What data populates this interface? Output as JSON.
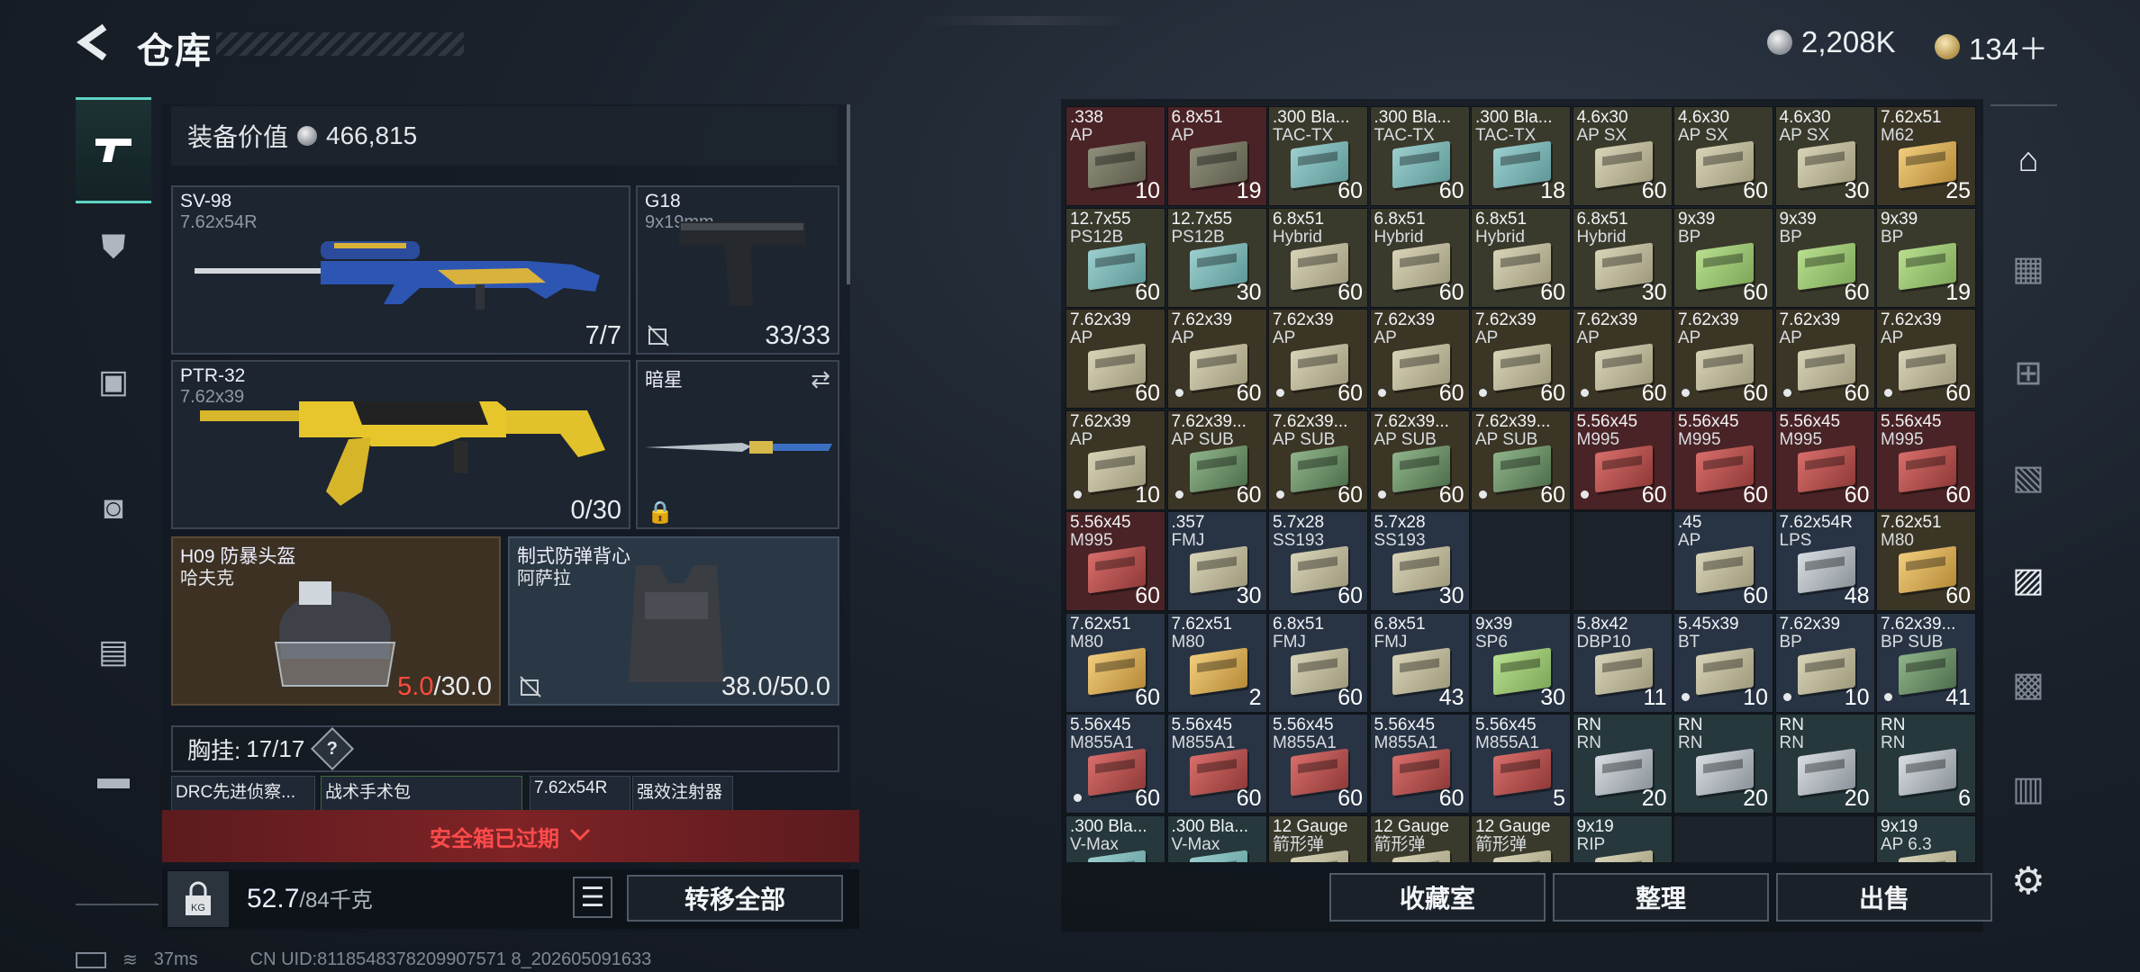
{
  "header": {
    "title": "仓库",
    "currency_silver": "2,208K",
    "currency_gold": "134＋"
  },
  "left": {
    "equip_value_label": "装备价值",
    "equip_value": "466,815",
    "slots": {
      "primary": {
        "name": "SV-98",
        "caliber": "7.62x54R",
        "count": "7/7"
      },
      "pistol": {
        "name": "G18",
        "caliber": "9x19mm",
        "count": "33/33"
      },
      "secondary": {
        "name": "PTR-32",
        "caliber": "7.62x39",
        "count": "0/30"
      },
      "melee": {
        "name": "暗星"
      },
      "helmet": {
        "name": "H09 防暴头盔",
        "sub": "哈夫克",
        "dur_cur": "5.0",
        "dur_max": "/30.0"
      },
      "armor": {
        "name": "制式防弹背心",
        "sub": "阿萨拉",
        "count": "38.0/50.0"
      }
    },
    "chest_rig_label": "胸挂:",
    "chest_rig_value": "17/17",
    "chest_help": "?",
    "mini_items": [
      "DRC先进侦察...",
      "战术手术包",
      "7.62x54R",
      "强效注射器"
    ],
    "safebox_expired": "安全箱已过期",
    "weight": "52.7",
    "weight_max": "/84千克",
    "transfer_all": "转移全部",
    "status_ping": "37ms",
    "status_uid": "CN UID:8118548378209907571 8_202605091633"
  },
  "grid": [
    [
      ".338",
      "AP",
      "10",
      "b-brown",
      "bg-red"
    ],
    [
      "6.8x51",
      "AP",
      "19",
      "b-brown",
      "bg-red"
    ],
    [
      ".300 Bla...",
      "TAC-TX",
      "60",
      "b-teal",
      "bg-olv"
    ],
    [
      ".300 Bla...",
      "TAC-TX",
      "60",
      "b-teal",
      "bg-olv"
    ],
    [
      ".300 Bla...",
      "TAC-TX",
      "18",
      "b-teal",
      "bg-olv"
    ],
    [
      "4.6x30",
      "AP SX",
      "60",
      "b-tan",
      "bg-olv"
    ],
    [
      "4.6x30",
      "AP SX",
      "60",
      "b-tan",
      "bg-olv"
    ],
    [
      "4.6x30",
      "AP SX",
      "30",
      "b-tan",
      "bg-olv"
    ],
    [
      "7.62x51",
      "M62",
      "25",
      "b-gold",
      "bg-brn"
    ],
    [
      "12.7x55",
      "PS12B",
      "60",
      "b-teal",
      "bg-olv"
    ],
    [
      "12.7x55",
      "PS12B",
      "30",
      "b-teal",
      "bg-olv"
    ],
    [
      "6.8x51",
      "Hybrid",
      "60",
      "b-tan",
      "bg-olv"
    ],
    [
      "6.8x51",
      "Hybrid",
      "60",
      "b-tan",
      "bg-olv"
    ],
    [
      "6.8x51",
      "Hybrid",
      "60",
      "b-tan",
      "bg-olv"
    ],
    [
      "6.8x51",
      "Hybrid",
      "30",
      "b-tan",
      "bg-olv"
    ],
    [
      "9x39",
      "BP",
      "60",
      "b-lime",
      "bg-olv"
    ],
    [
      "9x39",
      "BP",
      "60",
      "b-lime",
      "bg-olv"
    ],
    [
      "9x39",
      "BP",
      "19",
      "b-lime",
      "bg-olv"
    ],
    [
      "7.62x39",
      "AP",
      "60",
      "b-tan",
      "bg-brn"
    ],
    [
      "7.62x39",
      "AP",
      "60",
      "b-tan",
      "bg-brn"
    ],
    [
      "7.62x39",
      "AP",
      "60",
      "b-tan",
      "bg-brn"
    ],
    [
      "7.62x39",
      "AP",
      "60",
      "b-tan",
      "bg-brn"
    ],
    [
      "7.62x39",
      "AP",
      "60",
      "b-tan",
      "bg-brn"
    ],
    [
      "7.62x39",
      "AP",
      "60",
      "b-tan",
      "bg-brn"
    ],
    [
      "7.62x39",
      "AP",
      "60",
      "b-tan",
      "bg-brn"
    ],
    [
      "7.62x39",
      "AP",
      "60",
      "b-tan",
      "bg-brn"
    ],
    [
      "7.62x39",
      "AP",
      "60",
      "b-tan",
      "bg-brn"
    ],
    [
      "7.62x39",
      "AP",
      "10",
      "b-tan",
      "bg-brn"
    ],
    [
      "7.62x39...",
      "AP SUB",
      "60",
      "b-green",
      "bg-brn"
    ],
    [
      "7.62x39...",
      "AP SUB",
      "60",
      "b-green",
      "bg-brn"
    ],
    [
      "7.62x39...",
      "AP SUB",
      "60",
      "b-green",
      "bg-brn"
    ],
    [
      "7.62x39...",
      "AP SUB",
      "60",
      "b-green",
      "bg-brn"
    ],
    [
      "5.56x45",
      "M995",
      "60",
      "b-red",
      "bg-red"
    ],
    [
      "5.56x45",
      "M995",
      "60",
      "b-red",
      "bg-red"
    ],
    [
      "5.56x45",
      "M995",
      "60",
      "b-red",
      "bg-red"
    ],
    [
      "5.56x45",
      "M995",
      "60",
      "b-red",
      "bg-red"
    ],
    [
      "5.56x45",
      "M995",
      "60",
      "b-red",
      "bg-red"
    ],
    [
      ".357",
      "FMJ",
      "30",
      "b-tan",
      "bg-blu"
    ],
    [
      "5.7x28",
      "SS193",
      "60",
      "b-tan",
      "bg-blu"
    ],
    [
      "5.7x28",
      "SS193",
      "30",
      "b-tan",
      "bg-blu"
    ],
    [
      "",
      "",
      "",
      "",
      "bg-dk"
    ],
    [
      "",
      "",
      "",
      "",
      "bg-dk"
    ],
    [
      ".45",
      "AP",
      "60",
      "b-tan",
      "bg-blu"
    ],
    [
      "7.62x54R",
      "LPS",
      "48",
      "b-steel",
      "bg-blu"
    ],
    [
      "7.62x51",
      "M80",
      "60",
      "b-gold",
      "bg-brn"
    ],
    [
      "7.62x51",
      "M80",
      "60",
      "b-gold",
      "bg-blu"
    ],
    [
      "7.62x51",
      "M80",
      "2",
      "b-gold",
      "bg-blu"
    ],
    [
      "6.8x51",
      "FMJ",
      "60",
      "b-tan",
      "bg-blu"
    ],
    [
      "6.8x51",
      "FMJ",
      "43",
      "b-tan",
      "bg-blu"
    ],
    [
      "9x39",
      "SP6",
      "30",
      "b-lime",
      "bg-blu"
    ],
    [
      "5.8x42",
      "DBP10",
      "11",
      "b-tan",
      "bg-blu"
    ],
    [
      "5.45x39",
      "BT",
      "10",
      "b-tan",
      "bg-blu"
    ],
    [
      "7.62x39",
      "BP",
      "10",
      "b-tan",
      "bg-blu"
    ],
    [
      "7.62x39...",
      "BP SUB",
      "41",
      "b-green",
      "bg-blu"
    ],
    [
      "5.56x45",
      "M855A1",
      "60",
      "b-red",
      "bg-blu"
    ],
    [
      "5.56x45",
      "M855A1",
      "60",
      "b-red",
      "bg-blu"
    ],
    [
      "5.56x45",
      "M855A1",
      "60",
      "b-red",
      "bg-blu"
    ],
    [
      "5.56x45",
      "M855A1",
      "60",
      "b-red",
      "bg-blu"
    ],
    [
      "5.56x45",
      "M855A1",
      "5",
      "b-red",
      "bg-blu"
    ],
    [
      "RN",
      "RN",
      "20",
      "b-steel",
      "bg-teal"
    ],
    [
      "RN",
      "RN",
      "20",
      "b-steel",
      "bg-teal"
    ],
    [
      "RN",
      "RN",
      "20",
      "b-steel",
      "bg-teal"
    ],
    [
      "RN",
      "RN",
      "6",
      "b-steel",
      "bg-teal"
    ],
    [
      ".300 Bla...",
      "V-Max",
      "",
      "b-teal",
      "bg-teal"
    ],
    [
      ".300 Bla...",
      "V-Max",
      "",
      "b-teal",
      "bg-teal"
    ],
    [
      "12 Gauge",
      "箭形弹",
      "",
      "b-tan",
      "bg-olv"
    ],
    [
      "12 Gauge",
      "箭形弹",
      "",
      "b-tan",
      "bg-olv"
    ],
    [
      "12 Gauge",
      "箭形弹",
      "",
      "b-tan",
      "bg-olv"
    ],
    [
      "9x19",
      "RIP",
      "",
      "b-tan",
      "bg-teal"
    ],
    [
      "",
      "",
      "",
      "",
      "bg-dk"
    ],
    [
      "",
      "",
      "",
      "",
      "bg-dk"
    ],
    [
      "9x19",
      "AP 6.3",
      "",
      "b-tan",
      "bg-teal"
    ]
  ],
  "dots": [
    19,
    20,
    21,
    22,
    23,
    24,
    25,
    26,
    27,
    28,
    29,
    30,
    31,
    32,
    51,
    52,
    53,
    54
  ],
  "bottom_buttons": {
    "collection": "收藏室",
    "organize": "整理",
    "sell": "出售"
  },
  "icons": {
    "back": "back-arrow-icon",
    "gear": "gear-icon"
  }
}
